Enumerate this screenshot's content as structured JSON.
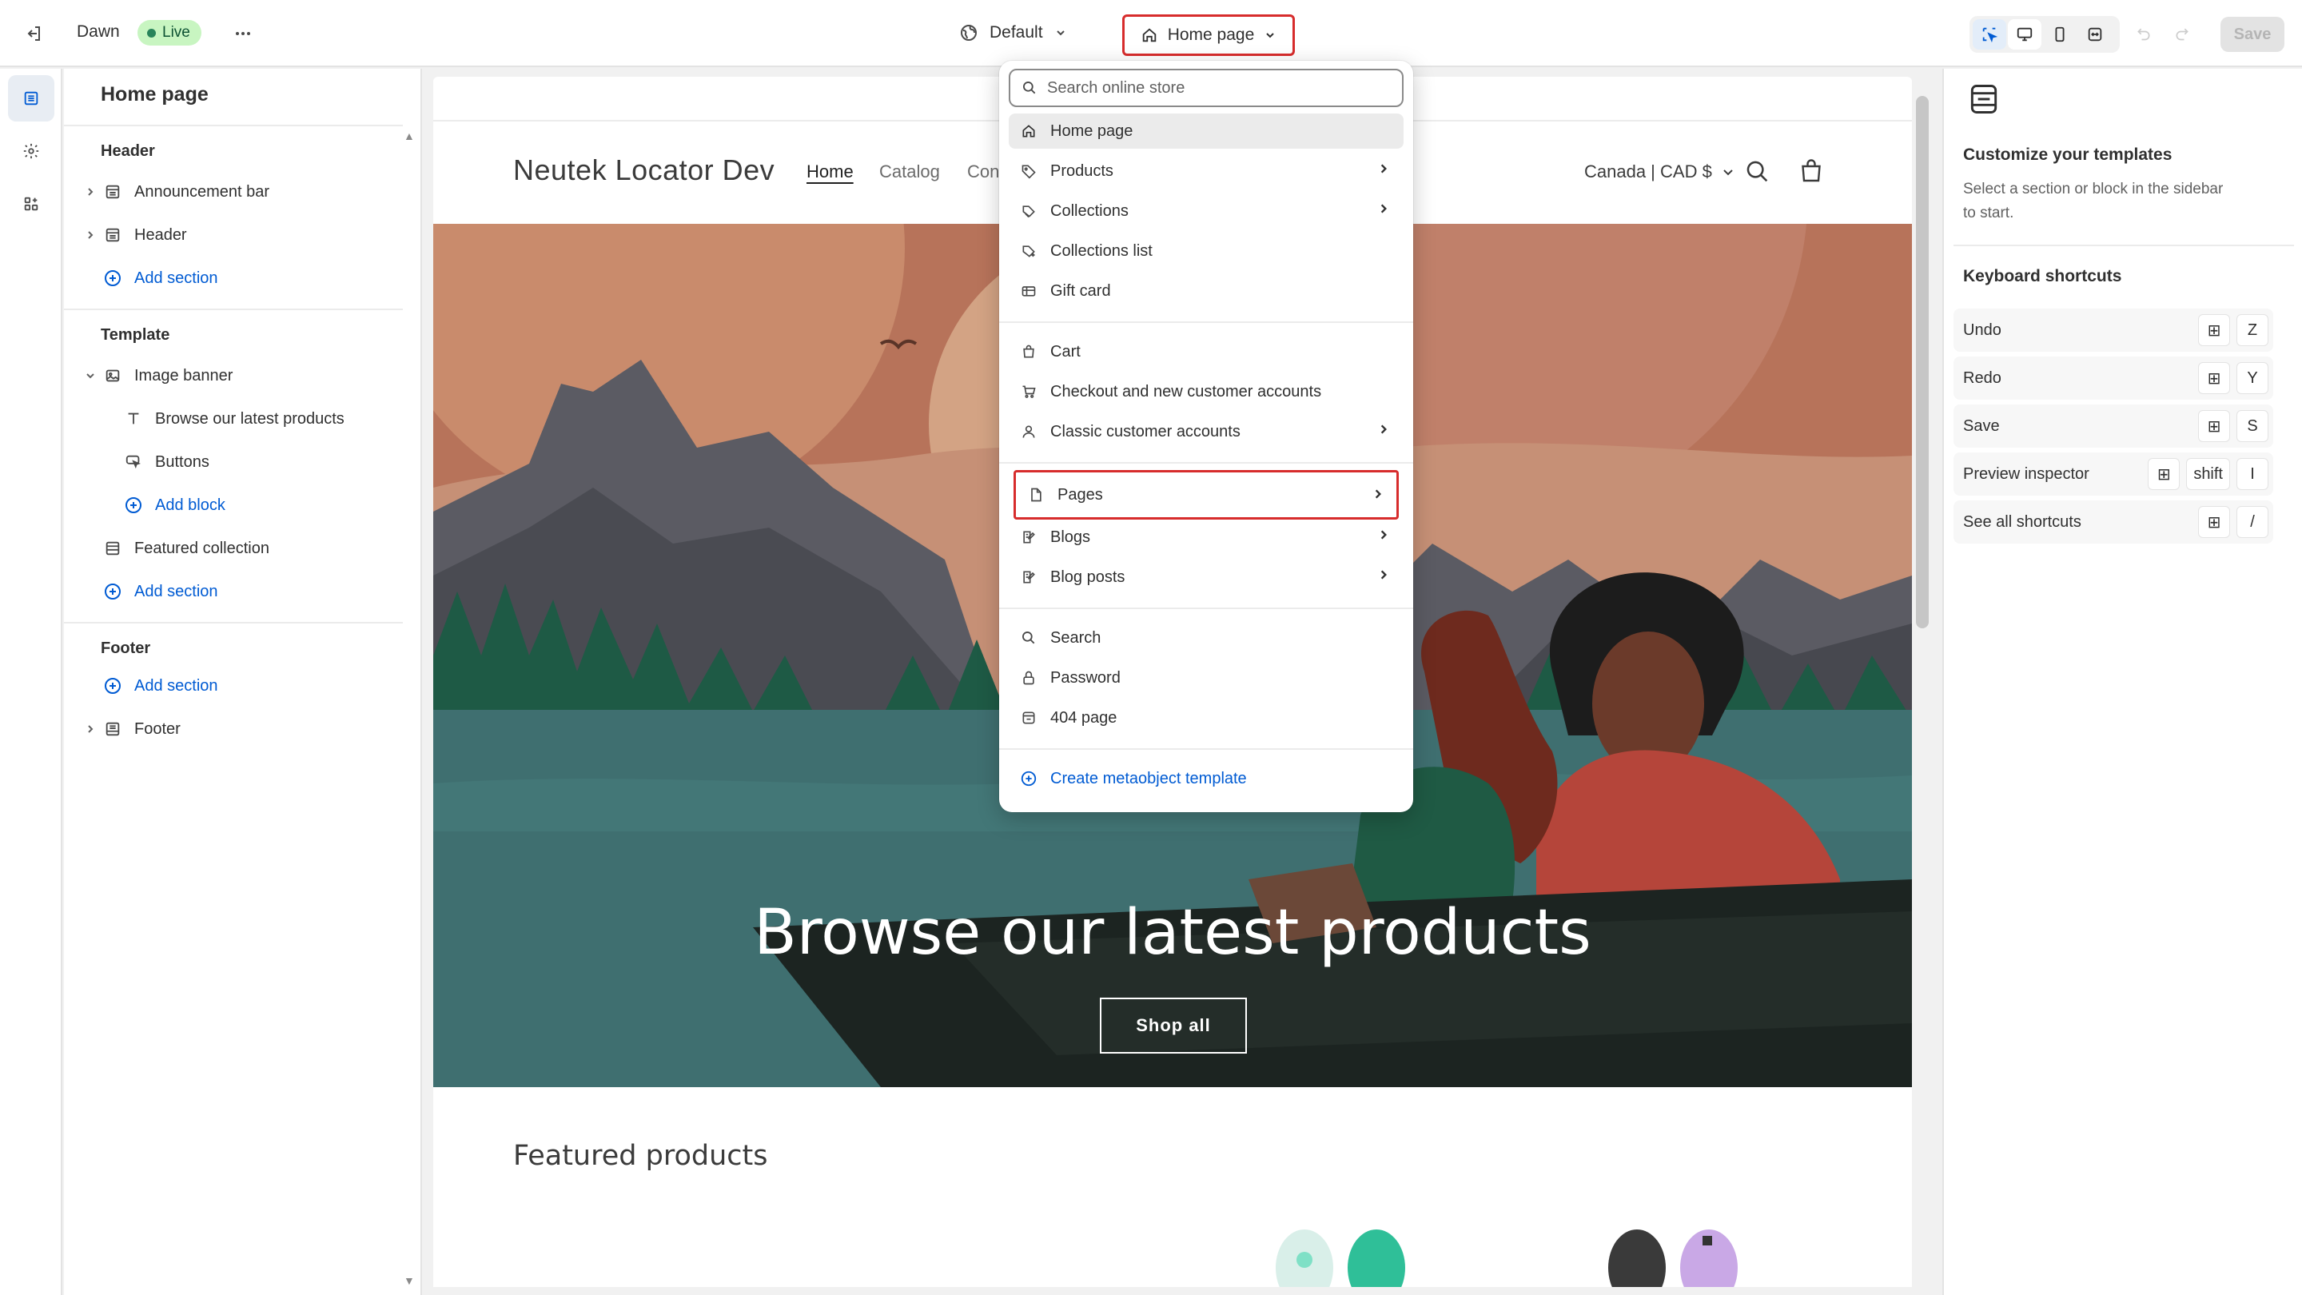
{
  "topbar": {
    "theme_name": "Dawn",
    "live_label": "Live",
    "theme_select_label": "Default",
    "page_select_label": "Home page",
    "save_label": "Save"
  },
  "sidebar": {
    "title": "Home page",
    "header_group": "Header",
    "header_items": [
      "Announcement bar",
      "Header"
    ],
    "add_section": "Add section",
    "template_group": "Template",
    "image_banner": "Image banner",
    "banner_blocks": [
      "Browse our latest products",
      "Buttons"
    ],
    "add_block": "Add block",
    "featured_collection": "Featured collection",
    "footer_group": "Footer",
    "footer_item": "Footer"
  },
  "store": {
    "name": "Neutek Locator Dev",
    "nav": [
      "Home",
      "Catalog",
      "Con"
    ],
    "currency": "Canada | CAD $",
    "banner_heading": "Browse our latest products",
    "banner_button": "Shop all",
    "featured_title": "Featured products"
  },
  "right_panel": {
    "title": "Customize your templates",
    "description": "Select a section or block in the sidebar to start.",
    "shortcuts_title": "Keyboard shortcuts",
    "shortcuts": [
      {
        "label": "Undo",
        "keys": [
          "Z"
        ]
      },
      {
        "label": "Redo",
        "keys": [
          "Y"
        ]
      },
      {
        "label": "Save",
        "keys": [
          "S"
        ]
      },
      {
        "label": "Preview inspector",
        "keys": [
          "shift",
          "I"
        ]
      },
      {
        "label": "See all shortcuts",
        "keys": [
          "/"
        ]
      }
    ]
  },
  "dropdown": {
    "search_placeholder": "Search online store",
    "groups": [
      [
        "Home page",
        "Products",
        "Collections",
        "Collections list",
        "Gift card"
      ],
      [
        "Cart",
        "Checkout and new customer accounts",
        "Classic customer accounts"
      ],
      [
        "Pages",
        "Blogs",
        "Blog posts"
      ],
      [
        "Search",
        "Password",
        "404 page"
      ]
    ],
    "create_label": "Create metaobject template"
  },
  "colors": {
    "accent": "#005bd3",
    "highlight_border": "#d72c2c",
    "live_badge_bg": "#c8f5c1",
    "live_dot": "#29845a"
  },
  "icons": [
    "exit-icon",
    "more-icon",
    "globe-icon",
    "home-icon",
    "chevron-down-icon",
    "inspector-icon",
    "desktop-icon",
    "mobile-icon",
    "fullwidth-icon",
    "undo-icon",
    "redo-icon",
    "sections-icon",
    "settings-icon",
    "apps-icon",
    "search-icon",
    "cart-icon",
    "tag-icon",
    "chevron-right-icon",
    "plus-circle-icon",
    "lock-icon",
    "person-icon",
    "page-icon",
    "blog-icon",
    "gift-icon"
  ]
}
